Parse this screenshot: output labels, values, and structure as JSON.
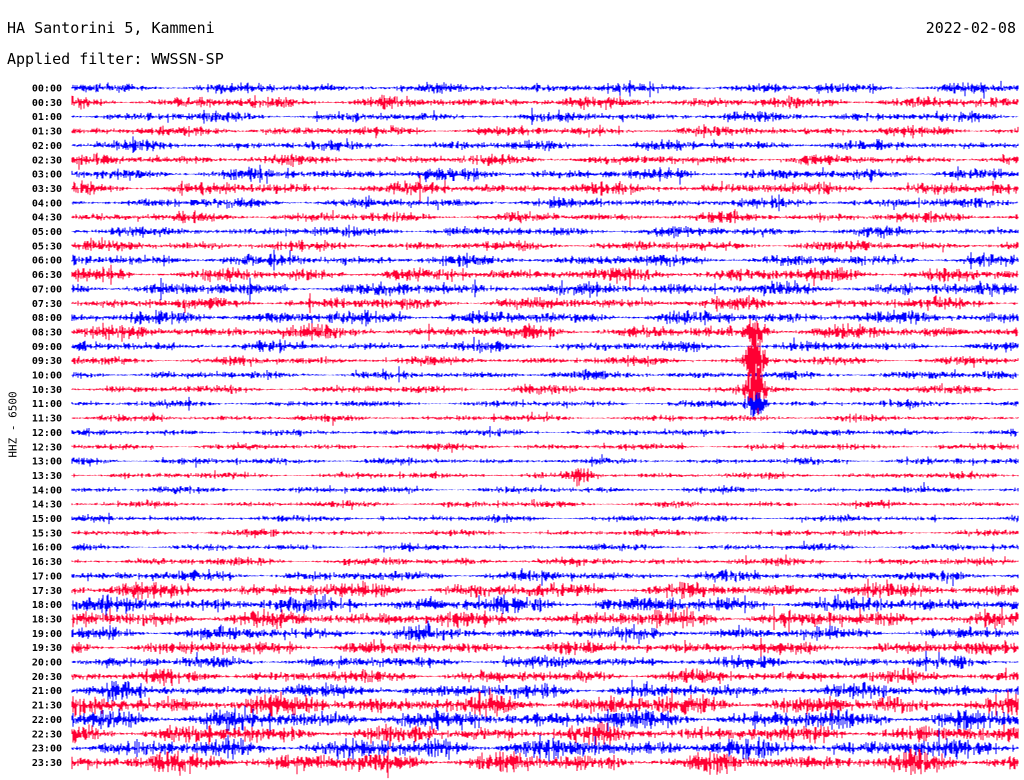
{
  "header": {
    "station": "HA Santorini 5, Kammeni",
    "date": "2022-02-08",
    "filter": "Applied filter: WWSSN-SP"
  },
  "chart_data": {
    "type": "line",
    "title": "HA Santorini 5, Kammeni",
    "ylabel": "HHZ - 6500",
    "categories": [
      "00:00",
      "00:30",
      "01:00",
      "01:30",
      "02:00",
      "02:30",
      "03:00",
      "03:30",
      "04:00",
      "04:30",
      "05:00",
      "05:30",
      "06:00",
      "06:30",
      "07:00",
      "07:30",
      "08:00",
      "08:30",
      "09:00",
      "09:30",
      "10:00",
      "10:30",
      "11:00",
      "11:30",
      "12:00",
      "12:30",
      "13:00",
      "13:30",
      "14:00",
      "14:30",
      "15:00",
      "15:30",
      "16:00",
      "16:30",
      "17:00",
      "17:30",
      "18:00",
      "18:30",
      "19:00",
      "19:30",
      "20:00",
      "20:30",
      "21:00",
      "21:30",
      "22:00",
      "22:30",
      "23:00",
      "23:30"
    ],
    "amplitude": [
      6,
      7,
      6,
      6,
      6,
      6,
      7,
      7,
      6,
      6,
      6,
      6,
      7,
      8,
      8,
      7,
      8,
      8,
      6,
      5,
      5,
      5,
      4,
      4,
      4,
      4,
      4,
      4,
      4,
      4,
      4,
      4,
      4,
      5,
      6,
      9,
      10,
      10,
      8,
      8,
      7,
      8,
      9,
      12,
      12,
      11,
      12,
      12
    ],
    "colors": [
      "#0000ff",
      "#ff0033"
    ],
    "events": [
      {
        "trace_index": 17,
        "x_frac": 0.722,
        "amplitude": 16
      },
      {
        "trace_index": 19,
        "x_frac": 0.722,
        "amplitude": 30
      },
      {
        "trace_index": 21,
        "x_frac": 0.722,
        "amplitude": 30
      },
      {
        "trace_index": 22,
        "x_frac": 0.722,
        "amplitude": 14
      },
      {
        "trace_index": 27,
        "x_frac": 0.537,
        "amplitude": 12
      }
    ]
  }
}
